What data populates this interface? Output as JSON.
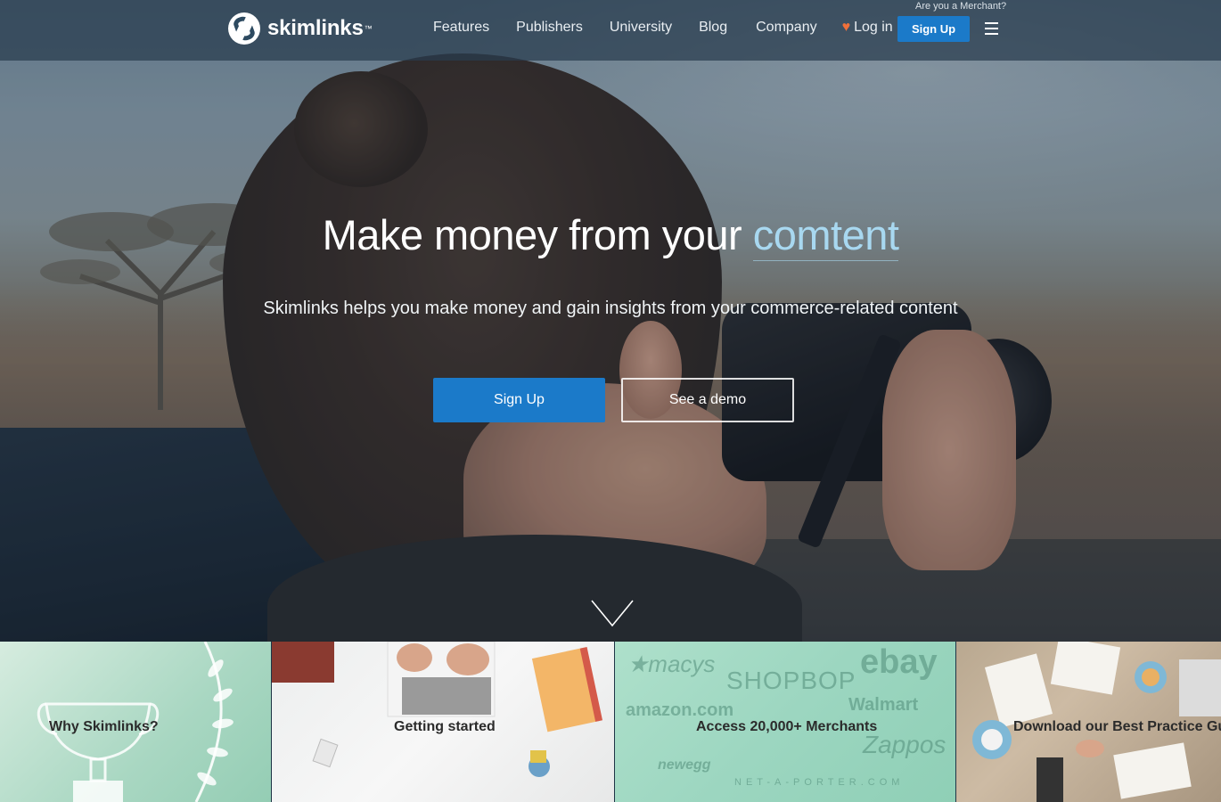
{
  "nav": {
    "logo_text": "skimlinks",
    "logo_tm": "™",
    "merchant_link": "Are you a Merchant?",
    "links": [
      "Features",
      "Publishers",
      "University",
      "Blog",
      "Company"
    ],
    "login": "Log in",
    "signup": "Sign Up",
    "menu_icon": "hamburger-icon",
    "heart_icon": "heart-icon"
  },
  "hero": {
    "title_prefix": "Make money from your ",
    "title_highlight": "comtent",
    "subtitle": "Skimlinks helps you make money and gain insights from your commerce-related content",
    "primary_button": "Sign Up",
    "secondary_button": "See a demo",
    "scroll_icon": "chevron-down-icon"
  },
  "tiles": [
    {
      "label": "Why Skimlinks?"
    },
    {
      "label": "Getting started"
    },
    {
      "label": "Access 20,000+ Merchants",
      "brands": [
        "★macys",
        "SHOPBOP",
        "ebay",
        "Walmart",
        "amazon.com",
        "Zappos",
        "newegg",
        "NET-A-PORTER.COM"
      ]
    },
    {
      "label": "Download our Best Practice Guide"
    }
  ],
  "colors": {
    "accent": "#1b7ac9",
    "highlight": "#a8d8f0",
    "heart": "#f0703a"
  }
}
